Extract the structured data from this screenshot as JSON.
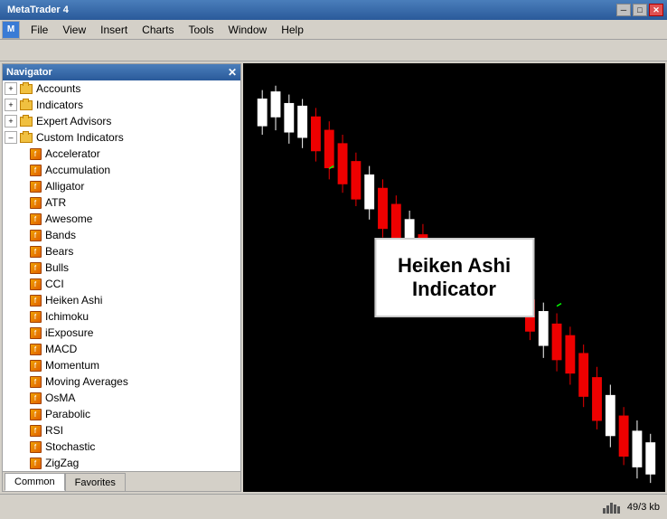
{
  "titleBar": {
    "title": "MetaTrader 4",
    "minimizeLabel": "─",
    "maximizeLabel": "□",
    "closeLabel": "✕"
  },
  "menuBar": {
    "items": [
      "File",
      "View",
      "Insert",
      "Charts",
      "Tools",
      "Window",
      "Help"
    ]
  },
  "navigator": {
    "title": "Navigator",
    "closeLabel": "✕",
    "tree": {
      "accounts": "Accounts",
      "indicators": "Indicators",
      "expertAdvisors": "Expert Advisors",
      "customIndicators": "Custom Indicators",
      "items": [
        "Accelerator",
        "Accumulation",
        "Alligator",
        "ATR",
        "Awesome",
        "Bands",
        "Bears",
        "Bulls",
        "CCI",
        "Heiken Ashi",
        "Ichimoku",
        "iExposure",
        "MACD",
        "Momentum",
        "Moving Averages",
        "OsMA",
        "Parabolic",
        "RSI",
        "Stochastic",
        "ZigZag"
      ]
    },
    "tabs": [
      {
        "label": "Common",
        "active": true
      },
      {
        "label": "Favorites",
        "active": false
      }
    ]
  },
  "chart": {
    "label": {
      "line1": "Heiken Ashi",
      "line2": "Indicator"
    }
  },
  "statusBar": {
    "size": "49/3 kb"
  }
}
